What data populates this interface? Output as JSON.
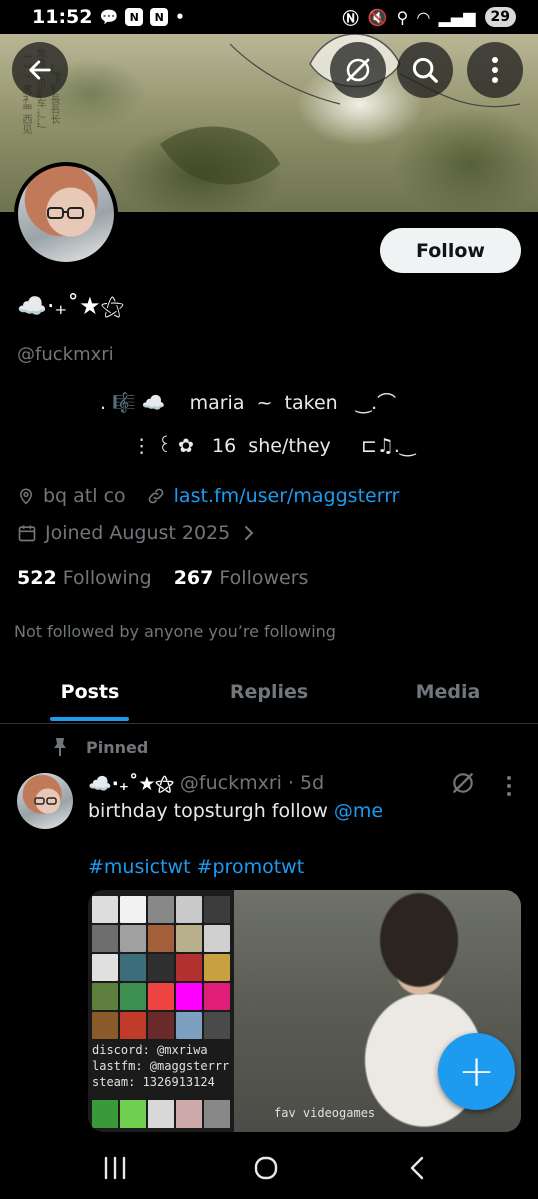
{
  "status_bar": {
    "time": "11:52",
    "battery": "29",
    "left_icons": [
      "chat-bubble-icon",
      "app-n-icon",
      "app-n-icon",
      "dot-icon"
    ],
    "right_icons": [
      "nfc-icon",
      "mute-icon",
      "location-icon",
      "wifi-icon",
      "signal-icon"
    ]
  },
  "header": {
    "back_icon": "arrow-left-icon",
    "grok_icon": "grok-icon",
    "search_icon": "search-icon",
    "more_icon": "more-vertical-icon"
  },
  "profile": {
    "follow_label": "Follow",
    "display_name": "☁️⋅₊˚★⚝",
    "handle": "@fuckmxri",
    "bio_line1": ". 🎼 ☁️    maria  ~  taken   ‿.⌒",
    "bio_line2": "  ⋮ ꒰ ✿   16  she/they     ⊏♫.‿",
    "location": "bq atl co",
    "website": "last.fm/user/maggsterrr",
    "joined": "Joined August 2025",
    "following_count": "522",
    "following_label": "Following",
    "followers_count": "267",
    "followers_label": "Followers",
    "not_followed": "Not followed by anyone you’re following"
  },
  "tabs": [
    {
      "label": "Posts",
      "active": true
    },
    {
      "label": "Replies",
      "active": false
    },
    {
      "label": "Media",
      "active": false
    }
  ],
  "post": {
    "pinned_label": "Pinned",
    "name": "☁️⋅₊˚★⚝",
    "handle": "@fuckmxri",
    "time": "· 5d",
    "text": "birthday topsturgh follow ",
    "mention": "@me",
    "hashtags": "#musictwt #promotwt",
    "media_caption_lines": [
      "discord: @mxriwa",
      "lastfm: @maggsterrr",
      "steam: 1326913124"
    ],
    "media_caption_right": "fav videogames"
  },
  "fab_label": "+",
  "colors": {
    "accent": "#1d9bf0",
    "background": "#000000",
    "muted": "#71767b",
    "text": "#e7e9ea"
  }
}
